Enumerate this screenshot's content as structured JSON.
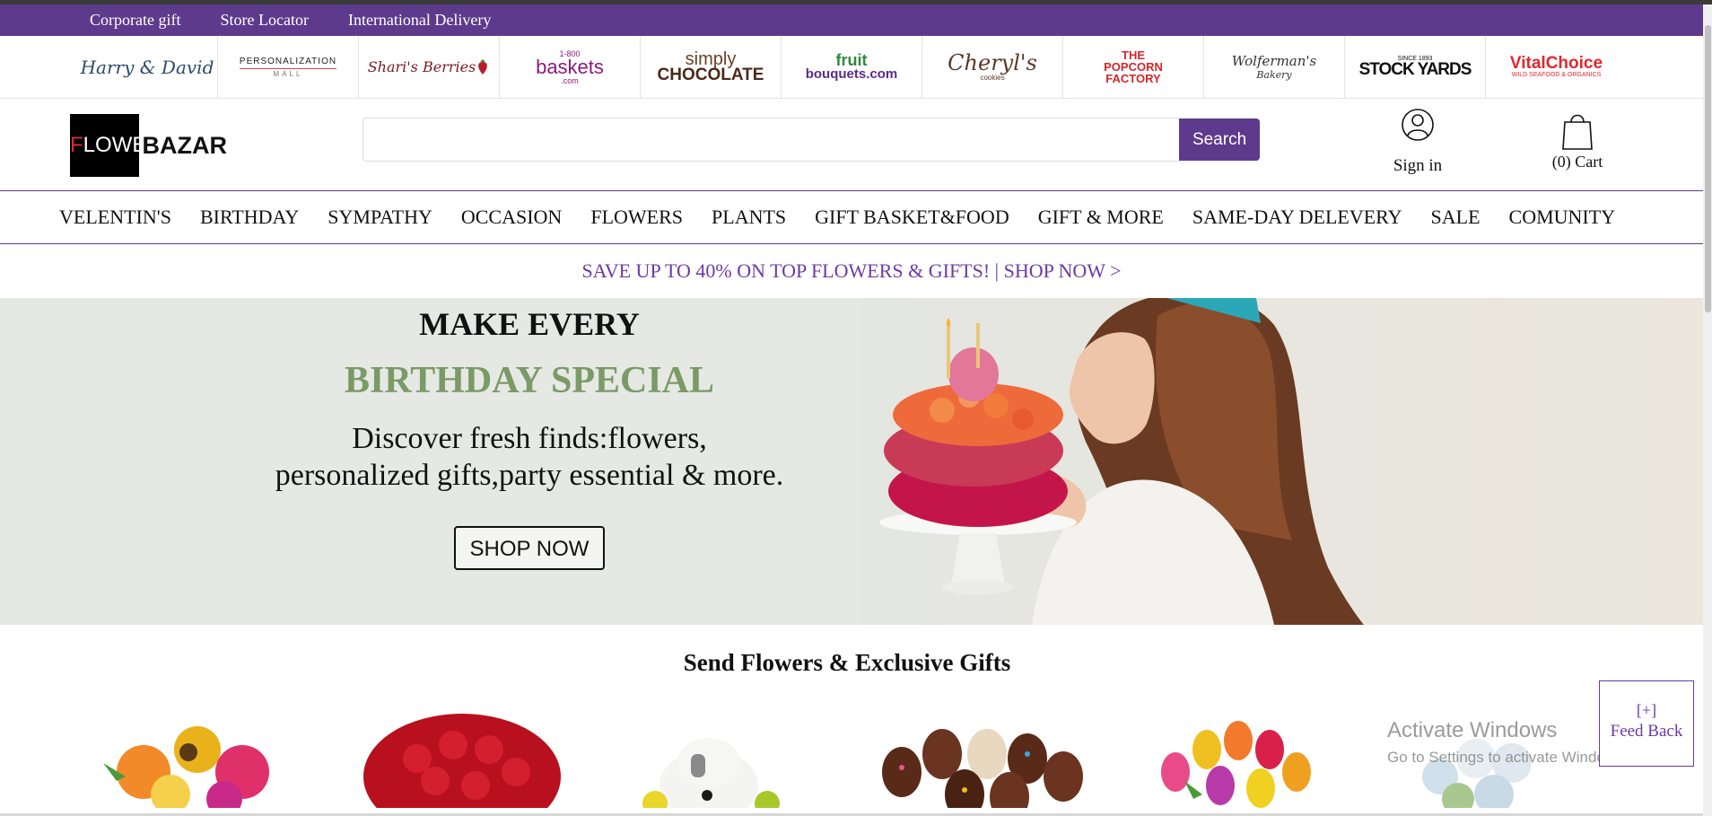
{
  "utility_links": [
    "Corporate gift",
    "Store Locator",
    "International Delivery"
  ],
  "brands": {
    "harry_david": "Harry & David",
    "personalization_line1": "PERSONALIZATION",
    "personalization_line2": "MALL",
    "sharis": "Shari's Berries",
    "baskets_top": "1-800",
    "baskets_main": "baskets",
    "baskets_sub": ".com",
    "simply": "simply",
    "chocolate": "CHOCOLATE",
    "fruit": "fruit",
    "bouquets": "bouquets.com",
    "cheryls": "Cheryl's",
    "cookies": "cookies",
    "popcorn": "THE POPCORN FACTORY",
    "wolferman": "Wolferman's",
    "bakery": "Bakery",
    "stockyards_top": "SINCE 1893",
    "stockyards": "STOCK YARDS",
    "vital": "VitalChoice",
    "vital_sub": "WILD SEAFOOD & ORGANICS"
  },
  "logo": {
    "prefix_red": "F",
    "prefix_white": "LOWERS",
    "suffix": "BAZAR"
  },
  "search": {
    "placeholder": "",
    "button": "Search"
  },
  "account": {
    "signin": "Sign in",
    "cart": "(0) Cart"
  },
  "nav": [
    "VELENTIN'S",
    "BIRTHDAY",
    "SYMPATHY",
    "OCCASION",
    "FLOWERS",
    "PLANTS",
    "GIFT BASKET&FOOD",
    "GIFT & MORE",
    "SAME-DAY DELEVERY",
    "SALE",
    "COMUNITY"
  ],
  "promo": "SAVE UP TO 40% ON TOP FLOWERS & GIFTS! | SHOP NOW >",
  "hero": {
    "line1": "MAKE EVERY",
    "line2": "BIRTHDAY SPECIAL",
    "desc1": "Discover fresh finds:flowers,",
    "desc2": "personalized gifts,party essential & more.",
    "cta": "SHOP NOW"
  },
  "section_title": "Send Flowers & Exclusive Gifts",
  "feedback": {
    "plus": "[+]",
    "label": "Feed Back"
  },
  "windows_notice": {
    "title": "Activate Windows",
    "subtitle": "Go to Settings to activate Windows."
  },
  "colors": {
    "brand_purple": "#5e3a8c",
    "promo_purple": "#6b3aa6",
    "hero_green": "#7a9a66"
  }
}
